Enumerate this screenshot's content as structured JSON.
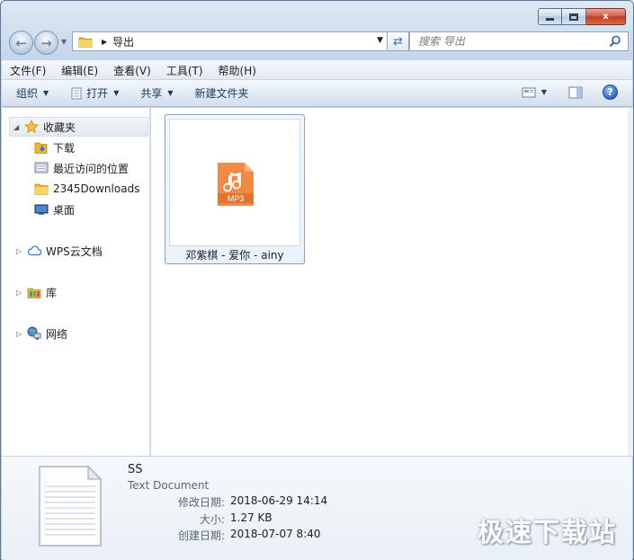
{
  "window": {
    "caption_min": "",
    "caption_max": "",
    "caption_close": "x"
  },
  "address": {
    "current": "导出"
  },
  "search": {
    "placeholder": "搜索 导出"
  },
  "menu": [
    "文件(F)",
    "编辑(E)",
    "查看(V)",
    "工具(T)",
    "帮助(H)"
  ],
  "toolbar": {
    "organize": "组织",
    "open": "打开",
    "share": "共享",
    "new_folder": "新建文件夹"
  },
  "nav": {
    "favorites": "收藏夹",
    "items": [
      "下载",
      "最近访问的位置",
      "2345Downloads",
      "桌面"
    ],
    "wps": "WPS云文档",
    "library": "库",
    "network": "网络"
  },
  "files": [
    {
      "name": "邓紫棋 - 爱你 - ainy",
      "icon": "mp3-file-icon",
      "badge": "MP3"
    }
  ],
  "details": {
    "name": "SS",
    "type": "Text Document",
    "modified_label": "修改日期:",
    "modified_value": "2018-06-29 14:14",
    "size_label": "大小:",
    "size_value": "1.27 KB",
    "created_label": "创建日期:",
    "created_value": "2018-07-07 8:40"
  },
  "watermark": "极速下载站",
  "colors": {
    "accent": "#3a6fb1",
    "mp3_orange": "#f08a45",
    "folder_yellow": "#e8b933"
  }
}
